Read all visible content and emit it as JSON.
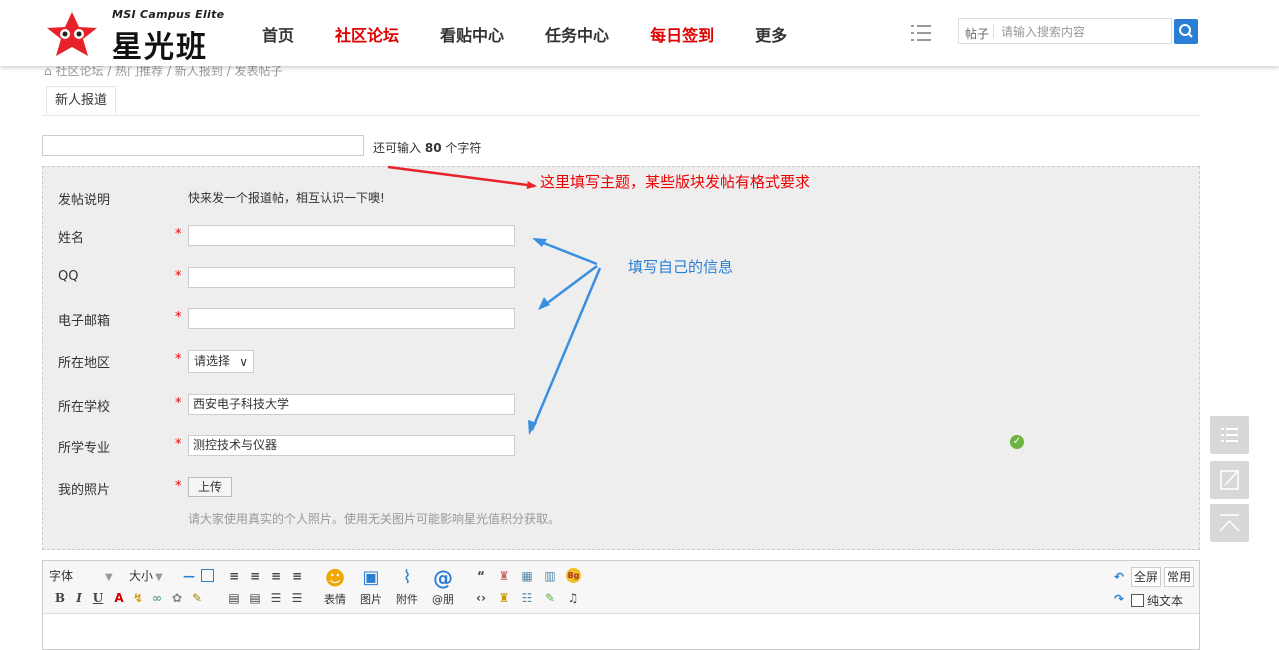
{
  "header": {
    "logo_sub": "MSI Campus Elite",
    "logo_main": "星光班",
    "nav": [
      {
        "label": "首页",
        "highlight": false
      },
      {
        "label": "社区论坛",
        "highlight": true
      },
      {
        "label": "看贴中心",
        "highlight": false
      },
      {
        "label": "任务中心",
        "highlight": false
      },
      {
        "label": "每日签到",
        "highlight": true
      },
      {
        "label": "更多",
        "highlight": false
      }
    ],
    "search": {
      "category": "帖子",
      "placeholder": "请输入搜索内容"
    }
  },
  "breadcrumb": "社区论坛 / 热门推荐 / 新人报到 / 发表帖子",
  "tabs": [
    {
      "label": "新人报道"
    }
  ],
  "subject": {
    "value": "",
    "counter_prefix": "还可输入",
    "counter_value": "80",
    "counter_suffix": "个字符"
  },
  "form": {
    "description_label": "发帖说明",
    "description_text": "快来发一个报道帖，相互认识一下噢!",
    "name_label": "姓名",
    "name_value": "",
    "qq_label": "QQ",
    "qq_value": "",
    "email_label": "电子邮箱",
    "email_value": "",
    "region_label": "所在地区",
    "region_value": "请选择",
    "school_label": "所在学校",
    "school_value": "西安电子科技大学",
    "major_label": "所学专业",
    "major_value": "测控技术与仪器",
    "photo_label": "我的照片",
    "upload_label": "上传",
    "photo_tip": "请大家使用真实的个人照片。使用无关图片可能影响星光值积分获取。",
    "required_mark": "*"
  },
  "annotations": {
    "red": "这里填写主题，某些版块发帖有格式要求",
    "blue": "填写自己的信息"
  },
  "editor": {
    "font_select": "字体",
    "size_select": "大小",
    "big_buttons": [
      {
        "label": "表情",
        "icon": "smiley-icon"
      },
      {
        "label": "图片",
        "icon": "image-icon"
      },
      {
        "label": "附件",
        "icon": "paperclip-icon"
      },
      {
        "label": "@朋",
        "icon": "at-icon"
      }
    ],
    "fullscreen": "全屏",
    "common": "常用",
    "plaintext": "纯文本"
  },
  "colors": {
    "accent_red": "#e00000",
    "accent_blue": "#2a7fd4",
    "success": "#6db33f"
  }
}
